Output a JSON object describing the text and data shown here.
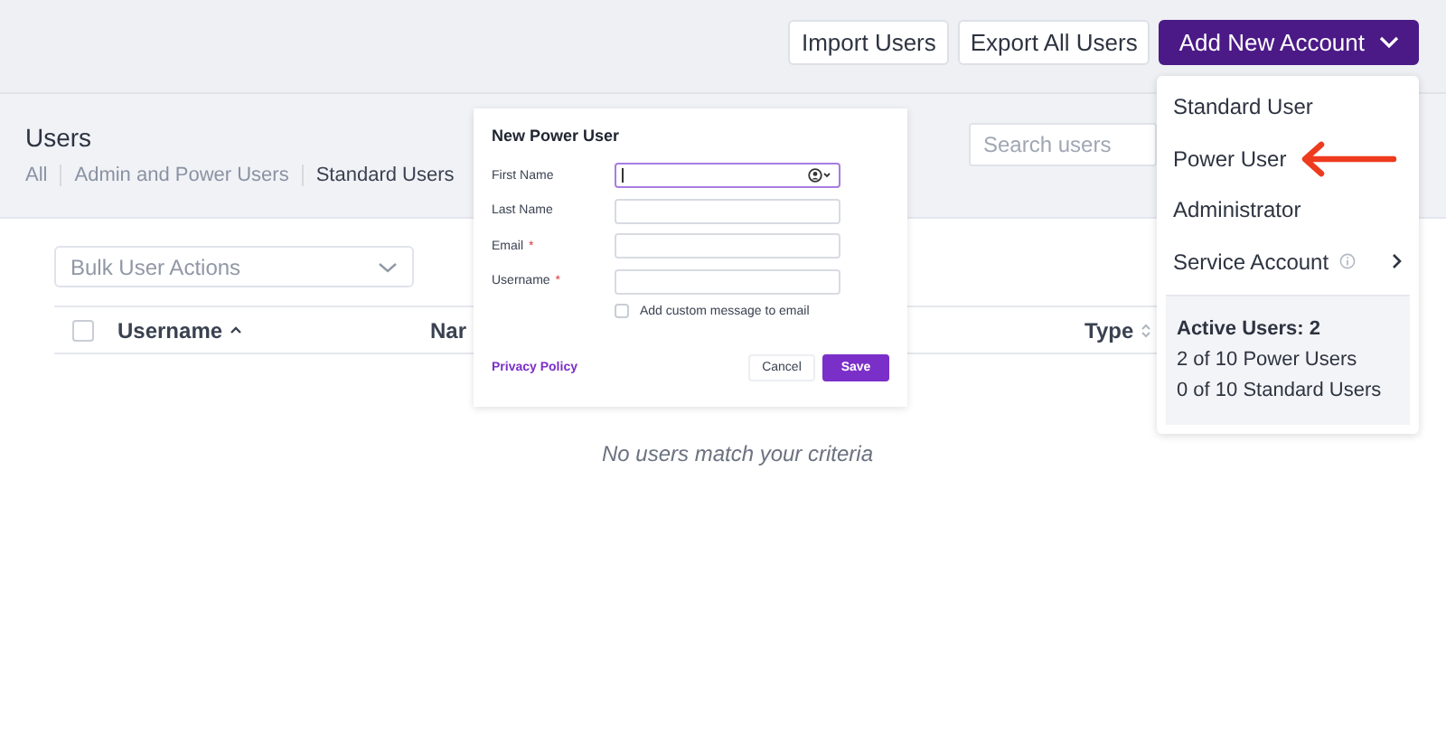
{
  "toolbar": {
    "buttons": [
      {
        "label": "Import Users",
        "kind": "plain"
      },
      {
        "label": "Export All Users",
        "kind": "plain"
      },
      {
        "label": "Add New Account",
        "kind": "primary"
      }
    ]
  },
  "users": {
    "title": "Users",
    "tabs": [
      {
        "label": "All",
        "selected": false
      },
      {
        "label": "Admin and Power Users",
        "selected": false
      },
      {
        "label": "Standard Users",
        "selected": true
      }
    ],
    "search": {
      "placeholder": "Search users"
    }
  },
  "bulk_actions": {
    "label": "Bulk User Actions"
  },
  "table": {
    "select_all": {
      "checked": false
    },
    "columns": [
      {
        "label": "Username",
        "kind": "ascending"
      },
      {
        "label": "Nar",
        "kind": "plain"
      },
      {
        "label": "Type",
        "kind": "sortable"
      }
    ],
    "empty_message": "No users match your criteria"
  },
  "dialog": {
    "title": "New Power User",
    "fields": [
      {
        "label": "First Name",
        "focused": true,
        "picker": true
      },
      {
        "label": "Last Name",
        "focused": false,
        "picker": false
      },
      {
        "label": "Email",
        "required_mark": "*",
        "focused": false,
        "picker": false
      },
      {
        "label": "Username",
        "required_mark": "*",
        "focused": false,
        "picker": false
      }
    ],
    "custom_message": {
      "label": "Add custom message to email",
      "checked": false
    },
    "link": "Privacy Policy",
    "buttons": [
      {
        "label": "Cancel",
        "kind": "plain"
      },
      {
        "label": "Save",
        "kind": "primary"
      }
    ]
  },
  "menu": {
    "items": [
      {
        "label": "Standard User",
        "kind": "plain",
        "pointed": false
      },
      {
        "label": "Power User",
        "kind": "plain",
        "pointed": true
      },
      {
        "label": "Administrator",
        "kind": "plain",
        "pointed": false
      },
      {
        "label": "Service Account",
        "kind": "submenu",
        "pointed": false
      }
    ],
    "summary": {
      "heading": "Active Users: 2",
      "lines": [
        "2 of 10 Power Users",
        "0 of 10 Standard Users"
      ]
    }
  }
}
